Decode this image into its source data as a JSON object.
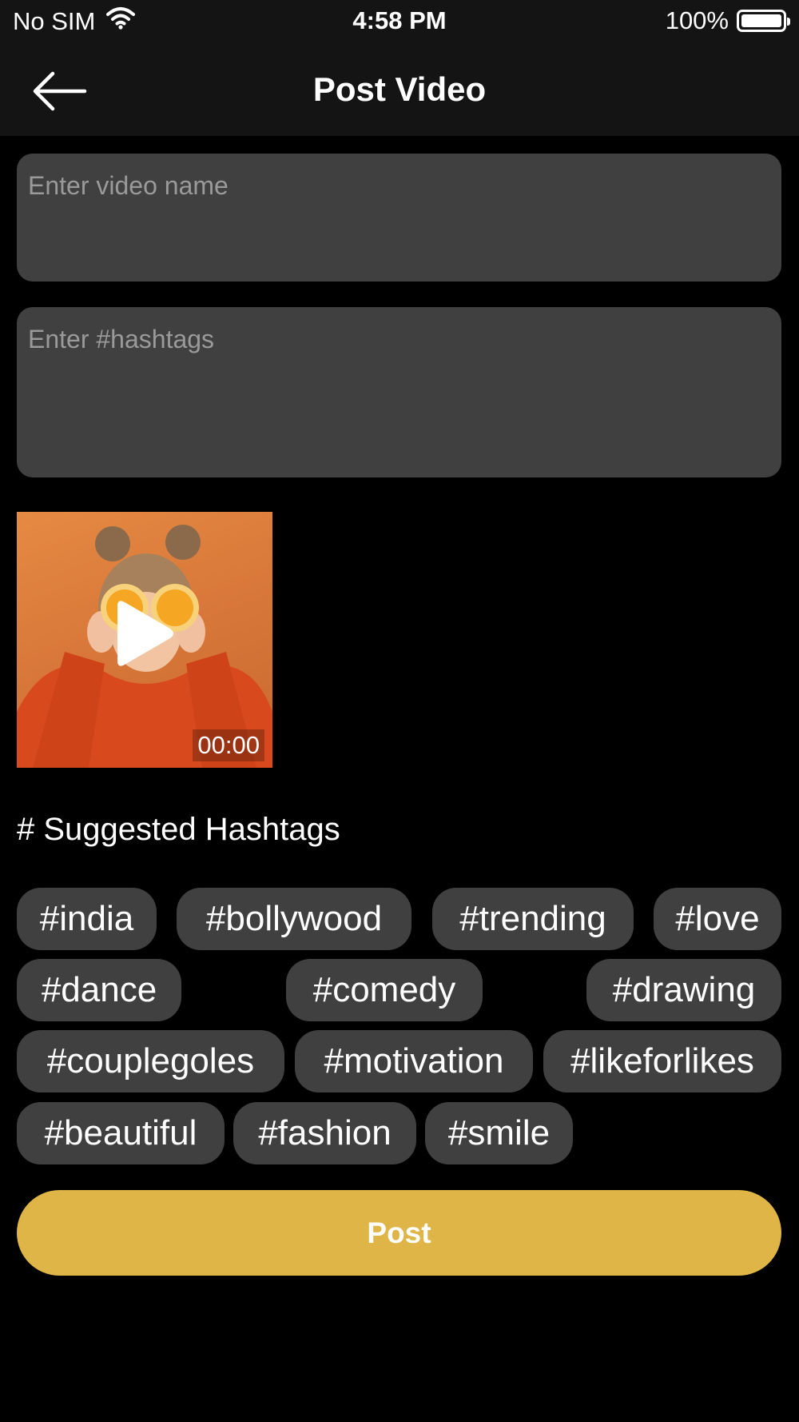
{
  "status_bar": {
    "carrier": "No SIM",
    "time": "4:58 PM",
    "battery_percent": "100%",
    "battery_level": 1.0
  },
  "header": {
    "title": "Post Video",
    "back_icon": "arrow-left-icon"
  },
  "form": {
    "video_name_placeholder": "Enter video name",
    "video_name_value": "",
    "hashtags_placeholder": "Enter #hashtags",
    "hashtags_value": ""
  },
  "video": {
    "duration": "00:00",
    "play_icon": "play-icon"
  },
  "suggested": {
    "title": "# Suggested Hashtags",
    "tags": [
      "#india",
      "#bollywood",
      "#trending",
      "#love",
      "#dance",
      "#comedy",
      "#drawing",
      "#couplegoles",
      "#motivation",
      "#likeforlikes",
      "#beautiful",
      "#fashion",
      "#smile"
    ]
  },
  "actions": {
    "post_label": "Post"
  },
  "colors": {
    "background": "#000000",
    "bar_background": "#141414",
    "field_background": "#404040",
    "chip_background": "#404040",
    "accent": "#e0b547"
  }
}
